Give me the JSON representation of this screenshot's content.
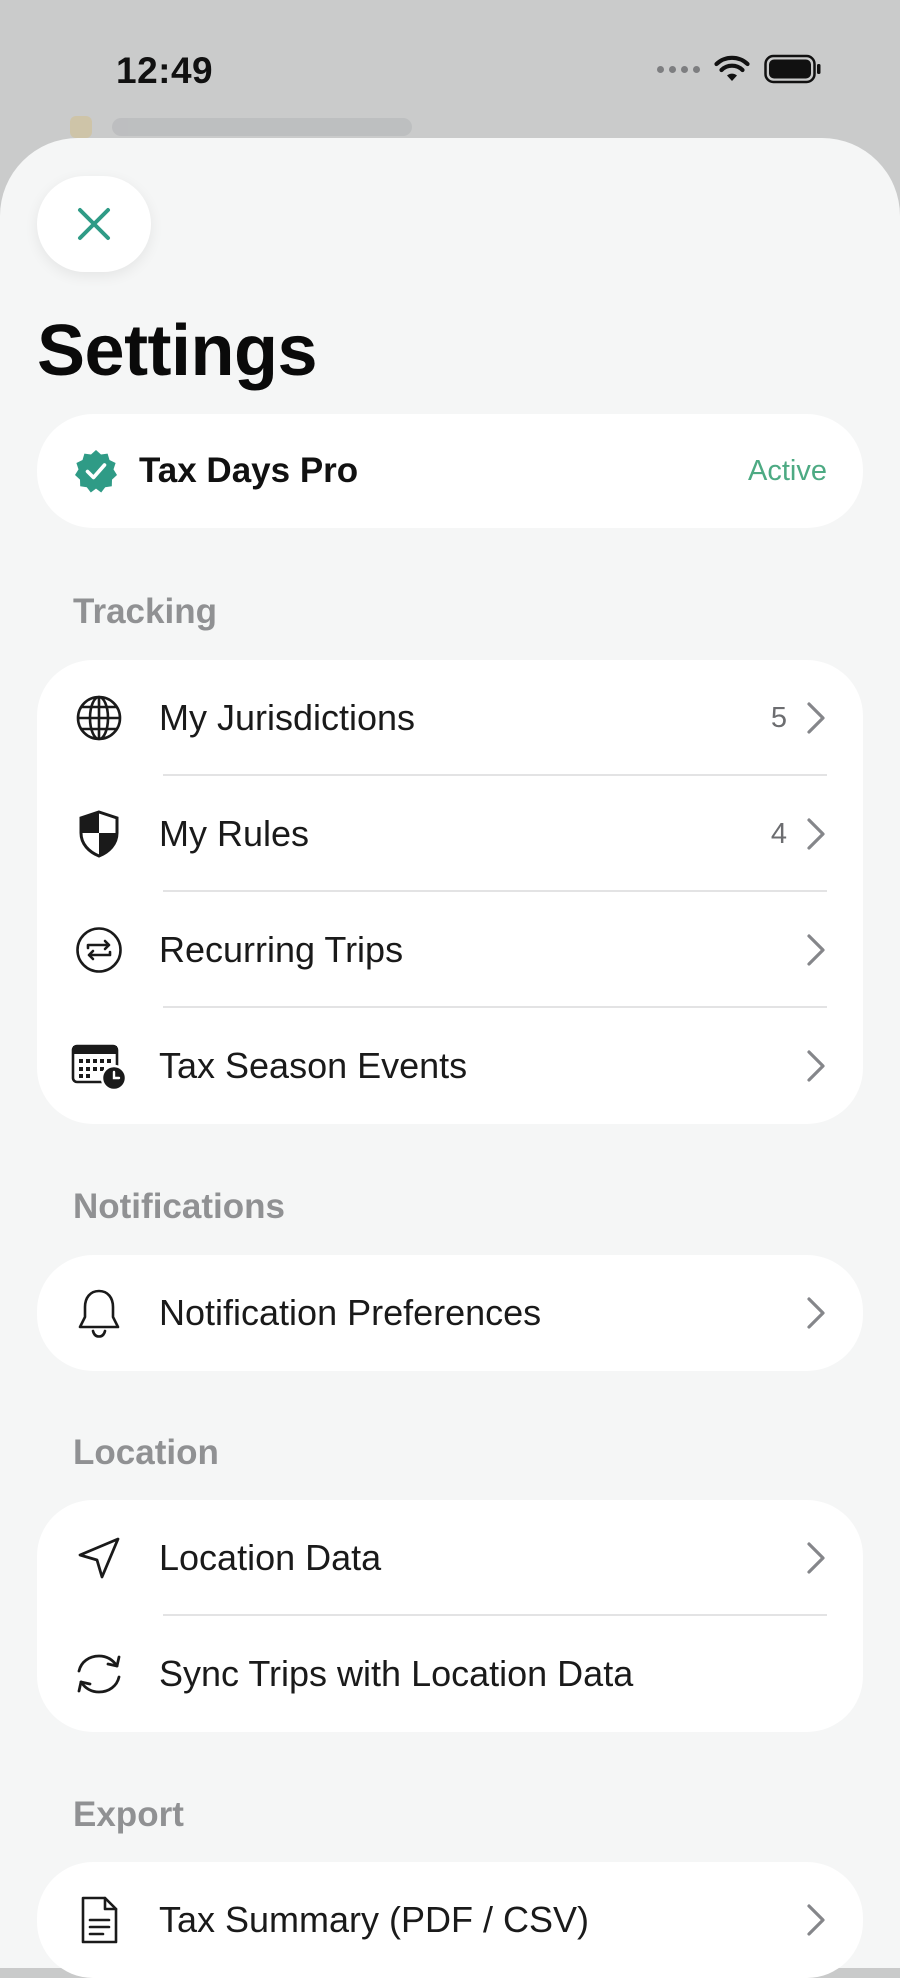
{
  "status_bar": {
    "time": "12:49"
  },
  "page": {
    "title": "Settings"
  },
  "subscription": {
    "name": "Tax Days Pro",
    "status": "Active"
  },
  "colors": {
    "accent": "#2f9b86",
    "active": "#4daa83",
    "section": "#909193"
  },
  "sections": {
    "tracking": {
      "label": "Tracking",
      "items": [
        {
          "label": "My Jurisdictions",
          "count": "5",
          "icon": "globe-icon"
        },
        {
          "label": "My Rules",
          "count": "4",
          "icon": "shield-icon"
        },
        {
          "label": "Recurring Trips",
          "count": "",
          "icon": "repeat-icon"
        },
        {
          "label": "Tax Season Events",
          "count": "",
          "icon": "calendar-clock-icon"
        }
      ]
    },
    "notifications": {
      "label": "Notifications",
      "items": [
        {
          "label": "Notification Preferences",
          "icon": "bell-icon"
        }
      ]
    },
    "location": {
      "label": "Location",
      "items": [
        {
          "label": "Location Data",
          "icon": "location-arrow-icon"
        },
        {
          "label": "Sync Trips with Location Data",
          "icon": "sync-icon"
        }
      ]
    },
    "export": {
      "label": "Export",
      "items": [
        {
          "label": "Tax Summary (PDF / CSV)",
          "icon": "document-icon"
        }
      ]
    }
  }
}
